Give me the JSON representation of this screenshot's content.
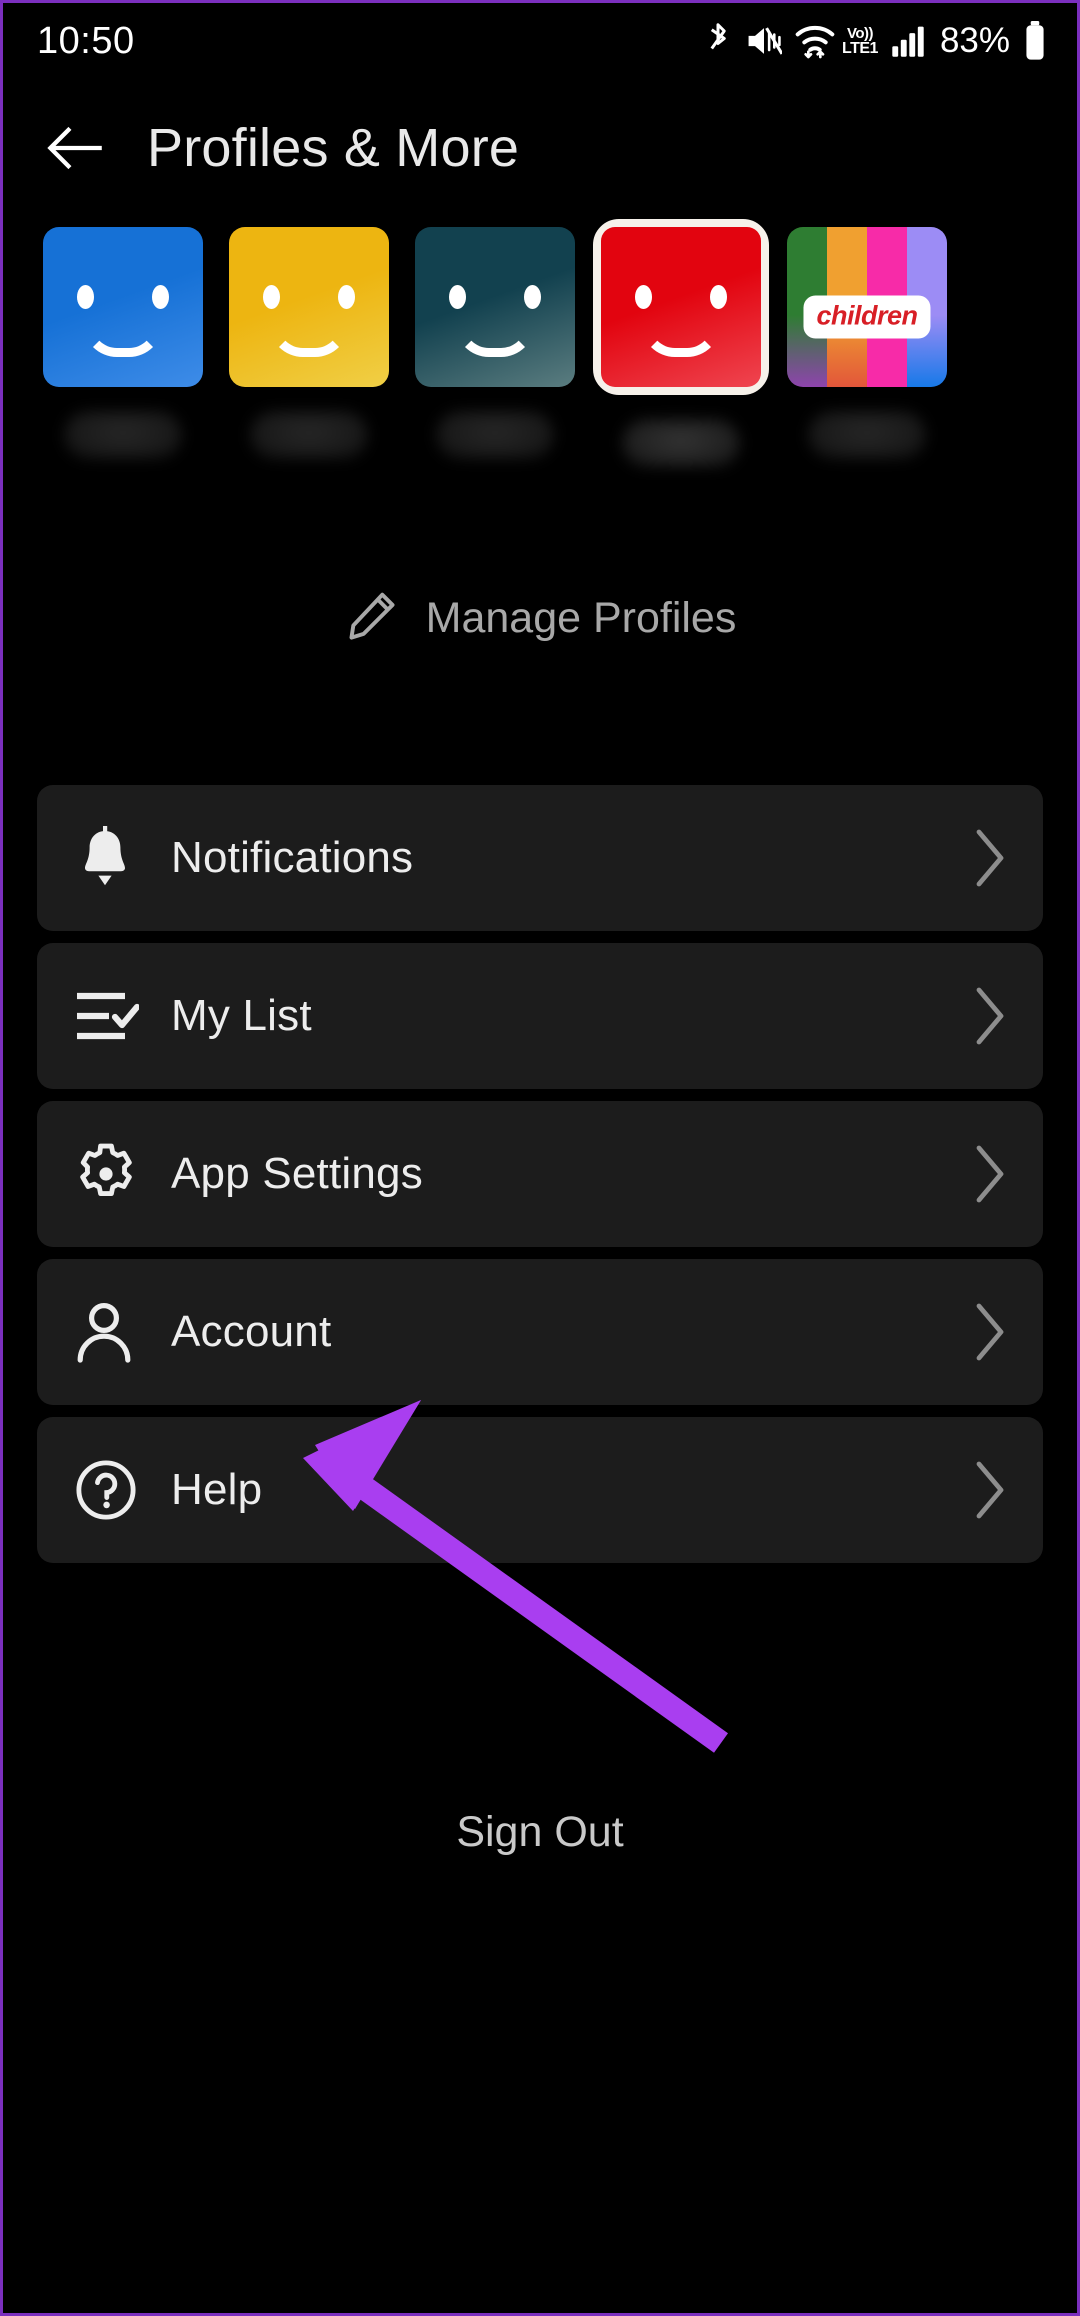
{
  "status_bar": {
    "time": "10:50",
    "battery_percent": "83%",
    "volte_top": "Vo))",
    "volte_bottom": "LTE1",
    "icons": [
      "bluetooth-icon",
      "mute-icon",
      "wifi-icon",
      "volte-icon",
      "signal-icon",
      "battery-icon"
    ]
  },
  "header": {
    "back_icon": "back-arrow-icon",
    "title": "Profiles & More"
  },
  "profiles": {
    "items": [
      {
        "name_hidden": true,
        "color": "#1671d6",
        "color2": "#3e8ce8",
        "type": "smiley",
        "selected": false
      },
      {
        "name_hidden": true,
        "color": "#edb511",
        "color2": "#f0cf46",
        "type": "smiley",
        "selected": false
      },
      {
        "name_hidden": true,
        "color": "#12414f",
        "color2": "#5b7d80",
        "type": "smiley",
        "selected": false
      },
      {
        "name_hidden": true,
        "color": "#e2040f",
        "color2": "#ef4550",
        "type": "smiley",
        "selected": true
      },
      {
        "name_hidden": true,
        "type": "kids",
        "label": "children",
        "selected": false,
        "stripes": [
          "#2e7d32",
          "#f0a030",
          "#f72ba8",
          "#9c8cf5"
        ],
        "stripes_bottom": [
          "#8e44ad",
          "#e2563a",
          "#f72ba8",
          "#1779e8"
        ]
      }
    ],
    "manage": {
      "icon": "pencil-icon",
      "label": "Manage Profiles"
    }
  },
  "menu": {
    "items": [
      {
        "id": "notifications",
        "label": "Notifications",
        "icon": "bell-icon",
        "chevron": "chevron-right-icon"
      },
      {
        "id": "my-list",
        "label": "My List",
        "icon": "list-check-icon",
        "chevron": "chevron-right-icon"
      },
      {
        "id": "app-settings",
        "label": "App Settings",
        "icon": "gear-icon",
        "chevron": "chevron-right-icon"
      },
      {
        "id": "account",
        "label": "Account",
        "icon": "person-icon",
        "chevron": "chevron-right-icon"
      },
      {
        "id": "help",
        "label": "Help",
        "icon": "question-circle-icon",
        "chevron": "chevron-right-icon"
      }
    ]
  },
  "footer": {
    "sign_out": "Sign Out"
  },
  "annotation": {
    "type": "arrow",
    "color": "#a93ef0",
    "points_to": "account",
    "name": "annotation-arrow"
  },
  "theme": {
    "background": "#000000",
    "row_background": "#1c1c1c",
    "text": "#ededed",
    "muted_text": "#a8a8a8",
    "accent": "#a93ef0"
  }
}
